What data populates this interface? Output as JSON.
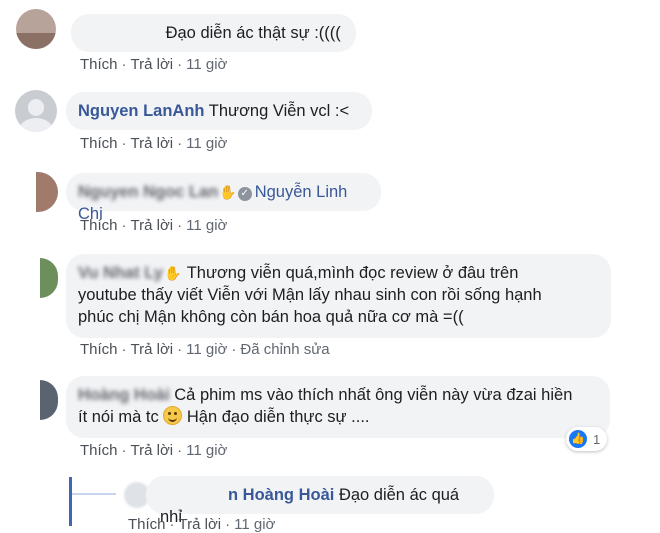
{
  "comments": [
    {
      "author": "",
      "text": "Đạo diễn ác thật sự :((((",
      "actions": {
        "like": "Thích",
        "reply": "Trả lời",
        "time": "11 giờ"
      }
    },
    {
      "author": "Nguyen LanAnh",
      "text": "Thương Viễn vcl :<",
      "actions": {
        "like": "Thích",
        "reply": "Trả lời",
        "time": "11 giờ"
      }
    },
    {
      "author": "Nguyen Ngoc Lan",
      "tagged": "Nguyễn Linh Chi",
      "text": "",
      "actions": {
        "like": "Thích",
        "reply": "Trả lời",
        "time": "11 giờ"
      }
    },
    {
      "author": "Vu Nhat Ly",
      "text_line1": "Thương viễn quá,mình đọc review ở đâu trên",
      "text_line2": "youtube thấy viết Viễn với Mận lấy nhau sinh con rồi sống hạnh",
      "text_line3": "phúc chị Mận không còn bán hoa quả nữa cơ mà =((",
      "actions": {
        "like": "Thích",
        "reply": "Trả lời",
        "time": "11 giờ",
        "edited": "Đã chỉnh sửa"
      }
    },
    {
      "author": "Hoàng Hoài",
      "text_line1": "Cả phim ms vào thích nhất ông viễn này vừa đzai hiền",
      "text_line2_a": "ít nói mà tc",
      "text_line2_b": "Hận đạo diễn thực sự ....",
      "reaction_count": "1",
      "actions": {
        "like": "Thích",
        "reply": "Trả lời",
        "time": "11 giờ"
      }
    }
  ],
  "reply": {
    "author_visible": "n Hoàng Hoài",
    "text": "Đạo diễn ác quá nhỉ",
    "actions": {
      "like": "Thích",
      "reply": "Trả lời",
      "time": "11 giờ"
    }
  },
  "icons": {
    "wave": "hand-wave-icon",
    "verified": "check-circle-icon",
    "like": "like-reaction-icon",
    "emoji": "smile-emoji-icon"
  },
  "colors": {
    "author": "#385898",
    "bubble": "#f2f3f5",
    "meta": "#606770",
    "like_blue": "#1877f2",
    "thread_line": "#4267b2"
  }
}
